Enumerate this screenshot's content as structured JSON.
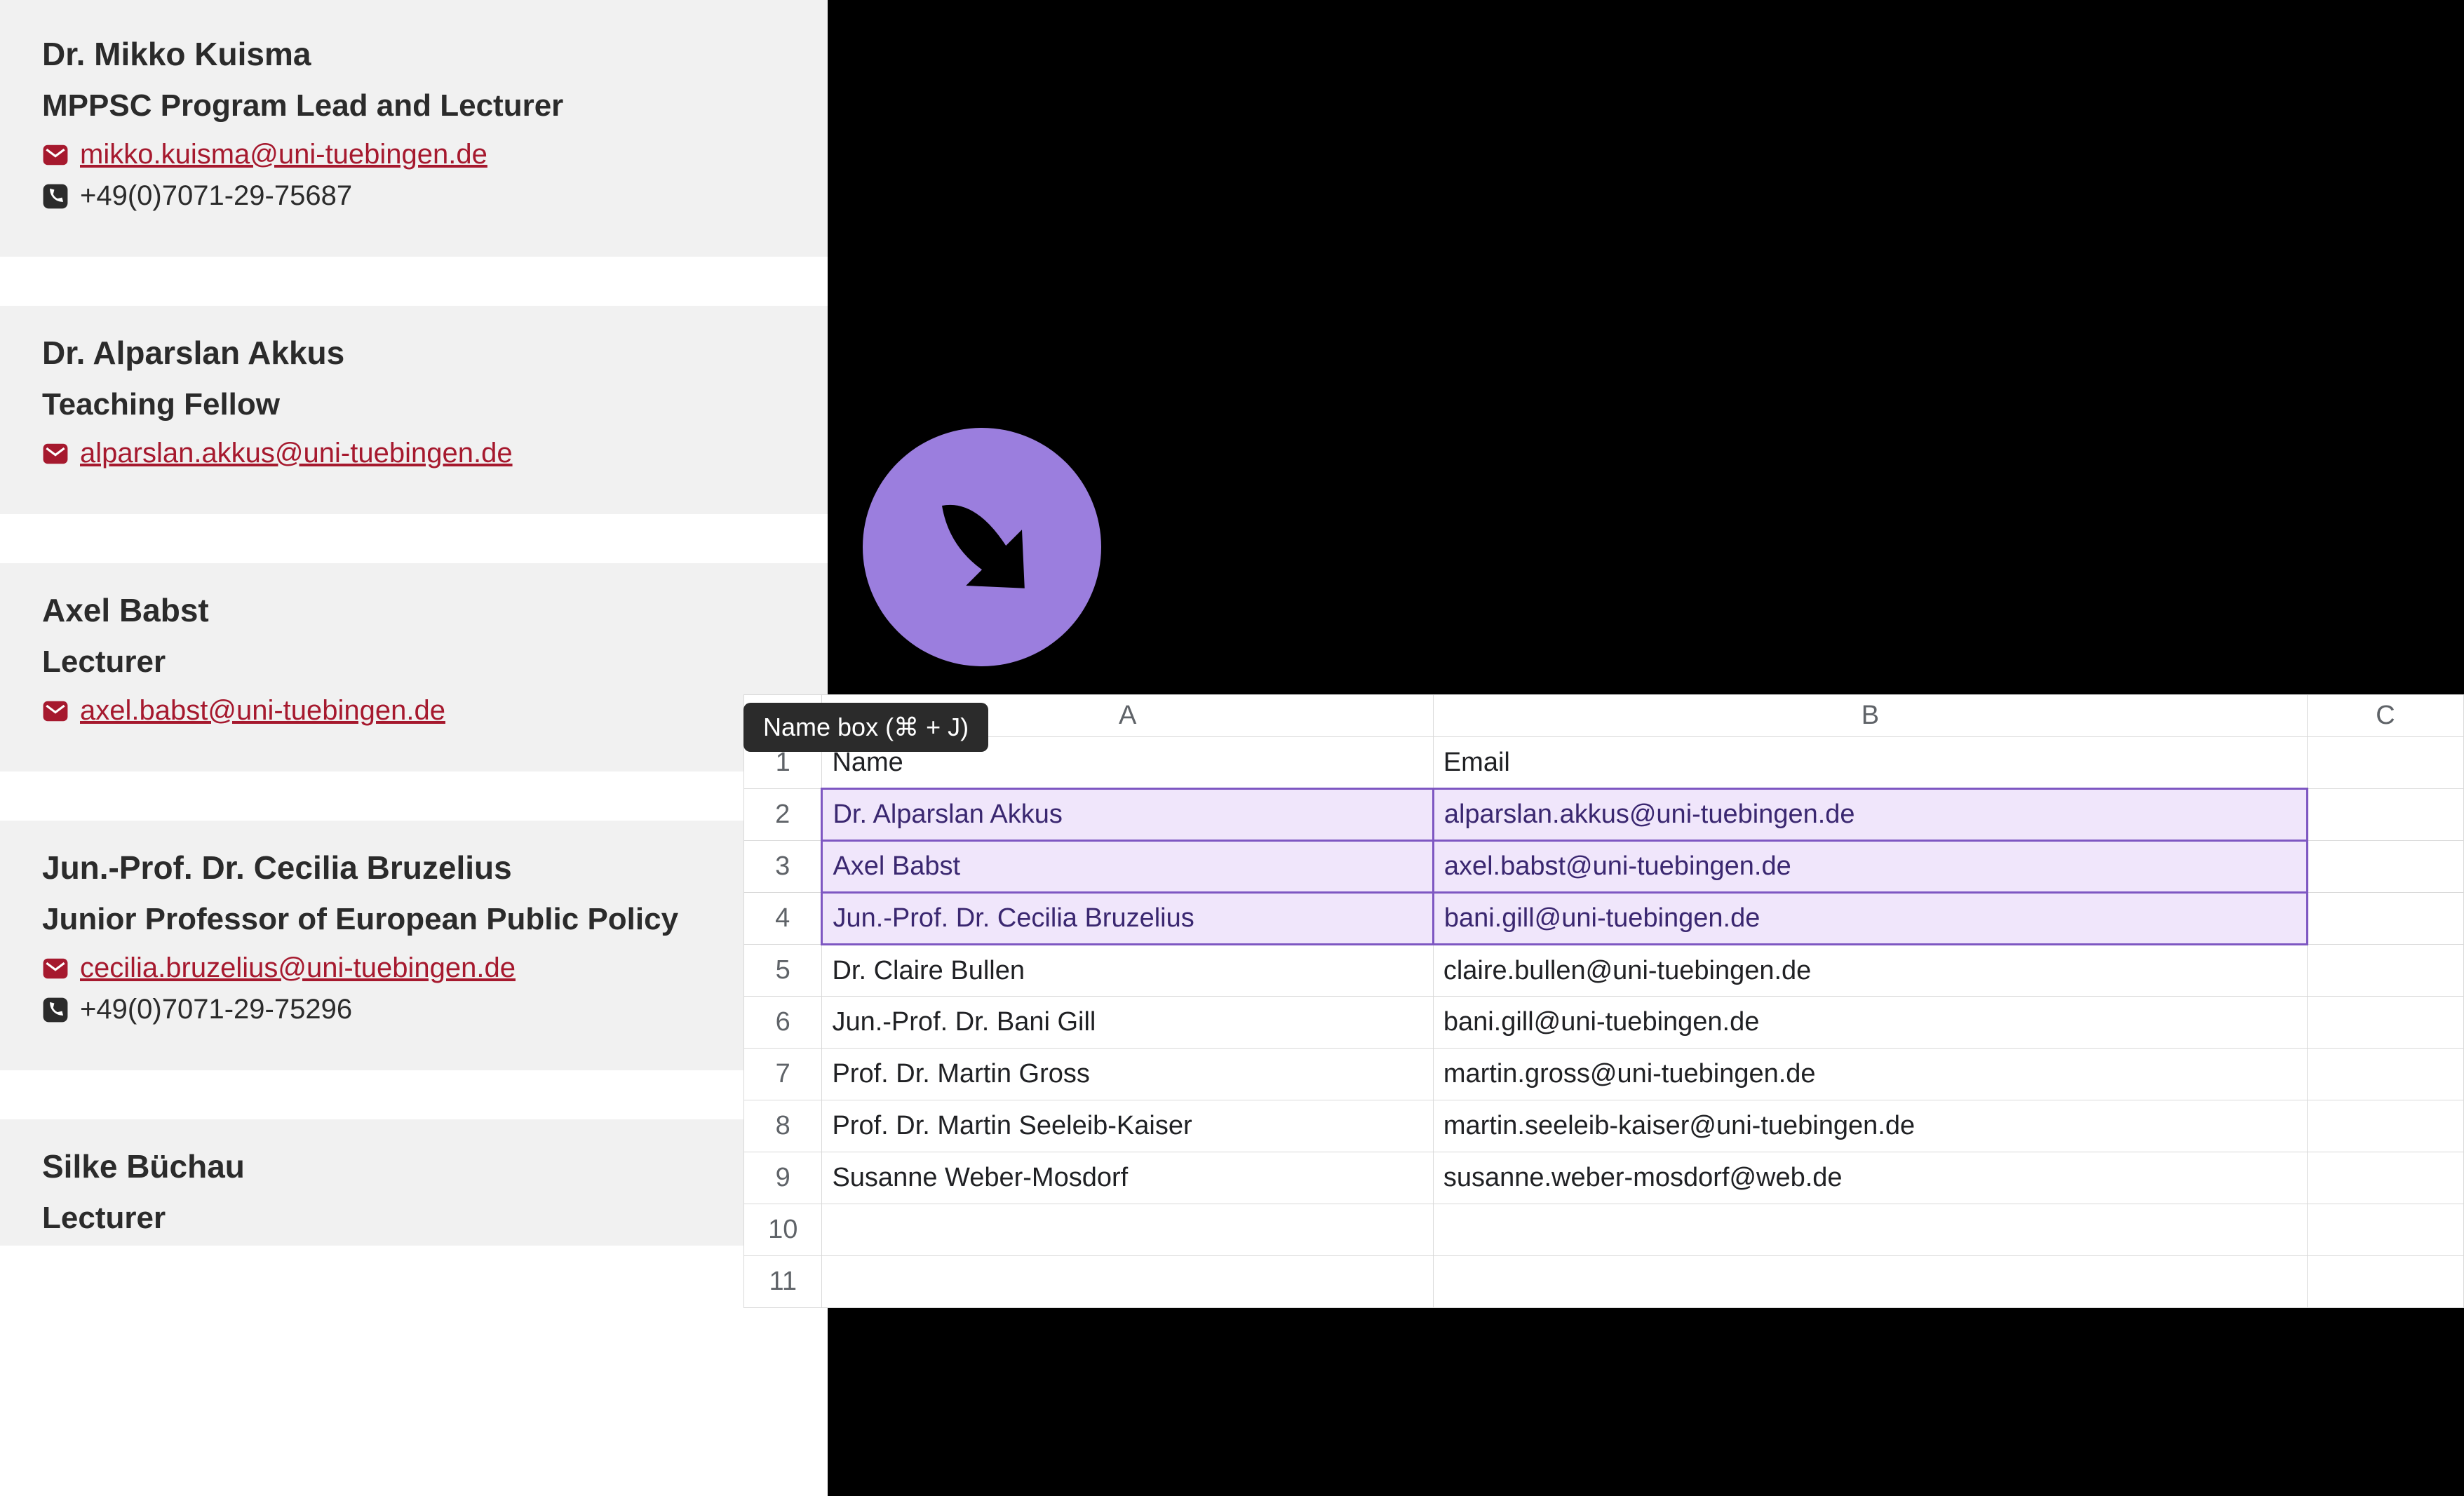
{
  "staff": [
    {
      "name": "Dr. Mikko Kuisma",
      "title": "MPPSC Program Lead and Lecturer",
      "email": "mikko.kuisma@uni-tuebingen.de",
      "phone": "+49(0)7071-29-75687"
    },
    {
      "name": "Dr. Alparslan Akkus",
      "title": "Teaching Fellow",
      "email": "alparslan.akkus@uni-tuebingen.de",
      "phone": ""
    },
    {
      "name": "Axel Babst",
      "title": "Lecturer",
      "email": "axel.babst@uni-tuebingen.de",
      "phone": ""
    },
    {
      "name": "Jun.-Prof. Dr. Cecilia Bruzelius",
      "title": "Junior Professor of European Public Policy",
      "email": "cecilia.bruzelius@uni-tuebingen.de",
      "phone": "+49(0)7071-29-75296"
    },
    {
      "name": "Silke Büchau",
      "title": "Lecturer",
      "email": "",
      "phone": ""
    }
  ],
  "tooltip": "Name box (⌘ + J)",
  "sheet": {
    "columns": [
      "A",
      "B",
      "C"
    ],
    "header_row": {
      "A": "Name",
      "B": "Email"
    },
    "rows": [
      {
        "n": 2,
        "A": "Dr. Alparslan Akkus",
        "B": "alparslan.akkus@uni-tuebingen.de",
        "hl": true
      },
      {
        "n": 3,
        "A": "Axel Babst",
        "B": "axel.babst@uni-tuebingen.de",
        "hl": true
      },
      {
        "n": 4,
        "A": "Jun.-Prof. Dr. Cecilia Bruzelius",
        "B": "bani.gill@uni-tuebingen.de",
        "hl": true
      },
      {
        "n": 5,
        "A": "Dr. Claire Bullen",
        "B": "claire.bullen@uni-tuebingen.de",
        "hl": false
      },
      {
        "n": 6,
        "A": "Jun.-Prof. Dr. Bani Gill",
        "B": "bani.gill@uni-tuebingen.de",
        "hl": false
      },
      {
        "n": 7,
        "A": "Prof. Dr. Martin Gross",
        "B": "martin.gross@uni-tuebingen.de",
        "hl": false
      },
      {
        "n": 8,
        "A": "Prof. Dr. Martin Seeleib-Kaiser",
        "B": "martin.seeleib-kaiser@uni-tuebingen.de",
        "hl": false
      },
      {
        "n": 9,
        "A": "Susanne Weber-Mosdorf",
        "B": "susanne.weber-mosdorf@web.de",
        "hl": false
      },
      {
        "n": 10,
        "A": "",
        "B": "",
        "hl": false
      },
      {
        "n": 11,
        "A": "",
        "B": "",
        "hl": false
      }
    ]
  }
}
